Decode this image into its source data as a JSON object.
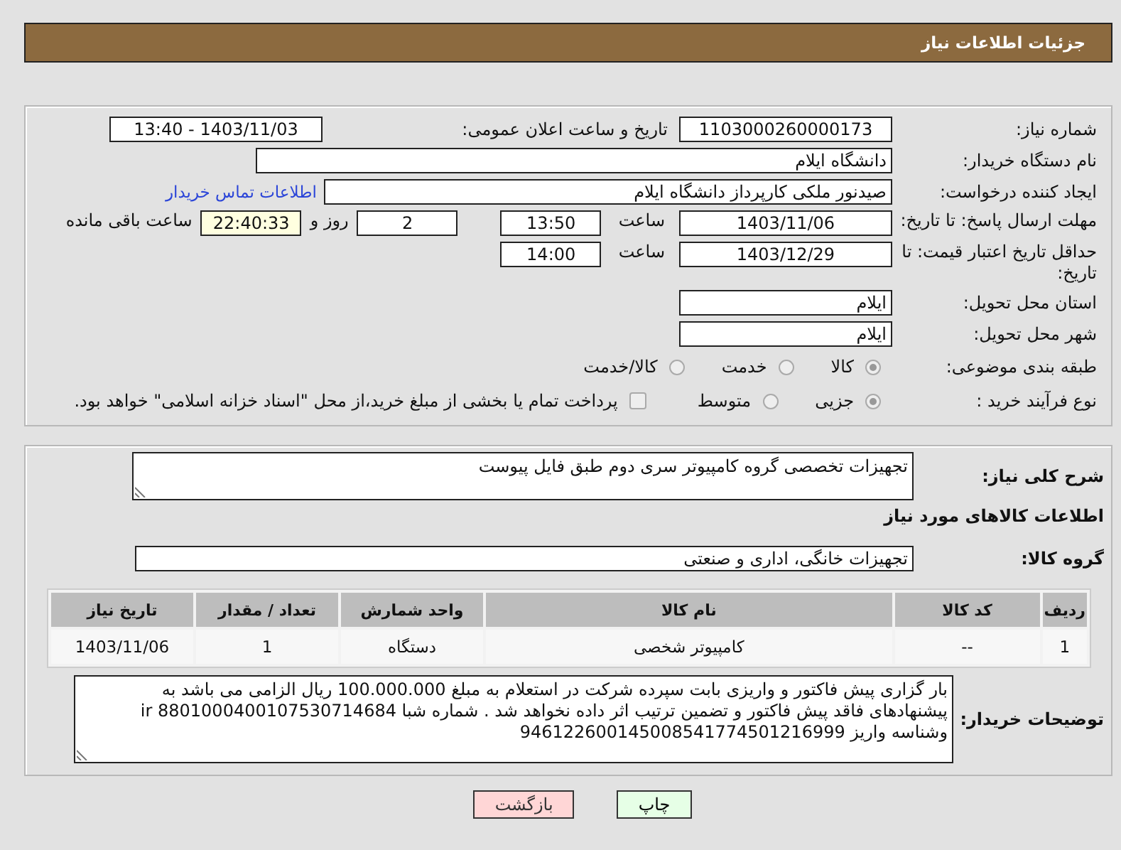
{
  "header": {
    "title": "جزئیات اطلاعات نیاز"
  },
  "form": {
    "need_number": {
      "label": "شماره نیاز:",
      "value": "1103000260000173"
    },
    "announcement": {
      "label": "تاریخ و ساعت اعلان عمومی:",
      "value": "1403/11/03 - 13:40"
    },
    "buyer_org": {
      "label": "نام دستگاه خریدار:",
      "value": "دانشگاه ایلام"
    },
    "requester": {
      "label": "ایجاد کننده درخواست:",
      "value": "صیدنور ملکی کارپرداز دانشگاه ایلام",
      "link": "اطلاعات تماس خریدار"
    },
    "reply_deadline": {
      "label": "مهلت ارسال پاسخ: تا تاریخ:",
      "date": "1403/11/06",
      "time_label": "ساعت",
      "time": "13:50",
      "days": "2",
      "days_label": "روز و",
      "remaining": "22:40:33",
      "remaining_label": "ساعت باقی مانده"
    },
    "price_validity": {
      "label": "حداقل تاریخ اعتبار قیمت: تا تاریخ:",
      "date": "1403/12/29",
      "time_label": "ساعت",
      "time": "14:00"
    },
    "province": {
      "label": "استان محل تحویل:",
      "value": "ایلام"
    },
    "city": {
      "label": "شهر محل تحویل:",
      "value": "ایلام"
    },
    "category": {
      "label": "طبقه بندی موضوعی:",
      "options": [
        {
          "label": "کالا",
          "selected": true
        },
        {
          "label": "خدمت",
          "selected": false
        },
        {
          "label": "کالا/خدمت",
          "selected": false
        }
      ]
    },
    "purchase_type": {
      "label": "نوع فرآیند خرید :",
      "options": [
        {
          "label": "جزیی",
          "selected": true
        },
        {
          "label": "متوسط",
          "selected": false
        }
      ],
      "payment": {
        "checked": false,
        "text": "پرداخت تمام یا بخشی از مبلغ خرید،از محل \"اسناد خزانه اسلامی\" خواهد بود."
      }
    }
  },
  "description": {
    "label": "شرح کلی نیاز:",
    "value": "تجهیزات تخصصی  گروه کامپیوتر سری دوم طبق فایل پیوست"
  },
  "goods": {
    "heading": "اطلاعات کالاهای مورد نیاز",
    "group_label": "گروه کالا:",
    "group_value": "تجهیزات خانگی، اداری و صنعتی",
    "table": {
      "columns": [
        "ردیف",
        "کد کالا",
        "نام کالا",
        "واحد شمارش",
        "تعداد / مقدار",
        "تاریخ نیاز"
      ],
      "rows": [
        [
          "1",
          "--",
          "کامپیوتر شخصی",
          "دستگاه",
          "1",
          "1403/11/06"
        ]
      ]
    }
  },
  "buyer_notes": {
    "label": "توضیحات خریدار:",
    "value": "بار گزاری پیش فاکتور و واریزی بابت سپرده شرکت در استعلام به مبلغ 100.000.000 ریال الزامی می باشد به پیشنهادهای فاقد پیش فاکتور و تضمین ترتیب اثر داده نخواهد شد . شماره شبا ir 8801000400107530714684 وشناسه واریز 946122600145008541774501216999"
  },
  "buttons": [
    {
      "label": "چاپ",
      "kind": "print"
    },
    {
      "label": "بازگشت",
      "kind": "back"
    }
  ]
}
